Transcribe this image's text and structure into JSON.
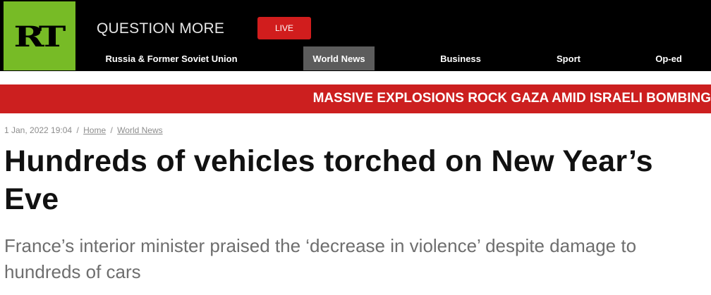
{
  "header": {
    "logo_text": "RT",
    "tagline": "QUESTION MORE",
    "live_label": "LIVE",
    "nav": [
      {
        "label": "Russia & Former Soviet Union",
        "active": false
      },
      {
        "label": "World News",
        "active": true
      },
      {
        "label": "Business",
        "active": false
      },
      {
        "label": "Sport",
        "active": false
      },
      {
        "label": "Op-ed",
        "active": false
      }
    ]
  },
  "breaking_banner": {
    "text": "MASSIVE EXPLOSIONS ROCK GAZA AMID ISRAELI BOMBING"
  },
  "article": {
    "date": "1 Jan, 2022 19:04",
    "separator": "/",
    "breadcrumbs": [
      "Home",
      "World News"
    ],
    "headline": "Hundreds of vehicles torched on New Year’s Eve",
    "summary": "France’s interior minister praised the ‘decrease in violence’ despite damage to hundreds of cars"
  },
  "colors": {
    "brand_green": "#77bb26",
    "live_red": "#d11d1d",
    "banner_red": "#cc1f1f",
    "active_nav_gray": "#5c5c5c"
  }
}
